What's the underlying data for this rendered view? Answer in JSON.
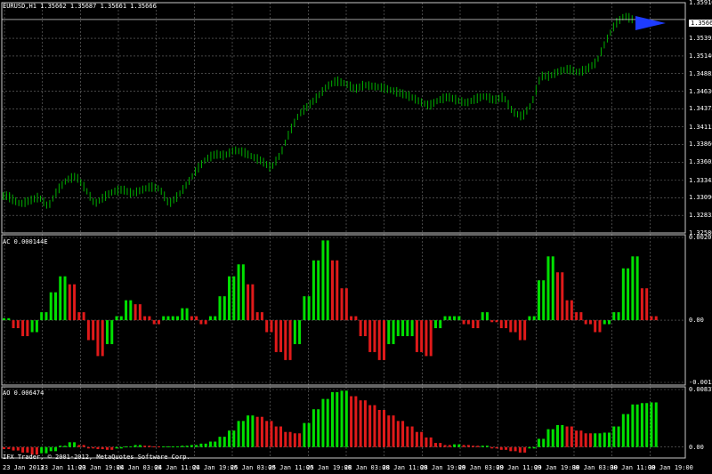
{
  "header": {
    "symbol_label": "EURUSD,H1  1.35662 1.35687 1.35661 1.35666",
    "ac_label": "AC 0.000144E",
    "ao_label": "AO 0.006474",
    "current_price": "1.35666"
  },
  "right_axis": {
    "price_ticks": [
      "1.35910",
      "1.35395",
      "1.35140",
      "1.34885",
      "1.34630",
      "1.34375",
      "1.34115",
      "1.33860",
      "1.33605",
      "1.33345",
      "1.33090",
      "1.32835",
      "1.32580"
    ],
    "ac_ticks": [
      "0.002075",
      "0.00",
      "-0.00156"
    ],
    "ao_ticks": [
      "0.008373",
      "0.00"
    ]
  },
  "time_axis": [
    "23 Jan 2013",
    "23 Jan 11:00",
    "23 Jan 19:00",
    "24 Jan 03:00",
    "24 Jan 11:00",
    "24 Jan 19:00",
    "25 Jan 03:00",
    "25 Jan 11:00",
    "25 Jan 19:00",
    "28 Jan 03:00",
    "28 Jan 11:00",
    "28 Jan 19:00",
    "29 Jan 03:00",
    "29 Jan 11:00",
    "29 Jan 19:00",
    "30 Jan 03:00",
    "30 Jan 11:00",
    "30 Jan 19:00"
  ],
  "copyright": "IFX Trader, © 2001-2012, MetaQuotes Software Corp.",
  "colors": {
    "background": "#000000",
    "grid": "#707070",
    "candles": "#00b000",
    "bar_up": "#00e000",
    "bar_down": "#e01a1a",
    "axis_text": "#ffffff",
    "arrow": "#1e3cff"
  },
  "chart_data": [
    {
      "type": "line",
      "title": "EURUSD,H1",
      "x_range": [
        "23 Jan 2013",
        "30 Jan 19:00"
      ],
      "ylim": [
        1.3258,
        1.3591
      ],
      "series": [
        {
          "name": "EURUSD",
          "values": [
            1.3312,
            1.3308,
            1.33,
            1.3305,
            1.331,
            1.3296,
            1.332,
            1.3335,
            1.334,
            1.3322,
            1.33,
            1.331,
            1.3318,
            1.3321,
            1.3315,
            1.332,
            1.3325,
            1.3322,
            1.33,
            1.3312,
            1.333,
            1.335,
            1.3365,
            1.3372,
            1.337,
            1.3378,
            1.3375,
            1.3368,
            1.3362,
            1.3352,
            1.3372,
            1.3405,
            1.343,
            1.3442,
            1.3455,
            1.347,
            1.3478,
            1.3474,
            1.3466,
            1.3472,
            1.347,
            1.3468,
            1.3464,
            1.346,
            1.3455,
            1.3448,
            1.3442,
            1.345,
            1.3455,
            1.345,
            1.3446,
            1.3452,
            1.3456,
            1.345,
            1.3455,
            1.3433,
            1.3426,
            1.3444,
            1.3485,
            1.3485,
            1.3492,
            1.3495,
            1.349,
            1.3495,
            1.3505,
            1.3535,
            1.356,
            1.3572,
            1.3566
          ]
        }
      ]
    },
    {
      "type": "bar",
      "title": "AC 0.000144E",
      "ylim": [
        -0.00156,
        0.002075
      ],
      "series": [
        {
          "name": "AC",
          "values": [
            5e-05,
            -0.0002,
            -0.0004,
            -0.0003,
            0.0002,
            0.0007,
            0.0011,
            0.0009,
            0.0002,
            -0.0005,
            -0.0009,
            -0.0006,
            0.0001,
            0.0005,
            0.0004,
            0.0001,
            -0.0001,
            0.0001,
            0.0001,
            0.0003,
            0.0001,
            -0.0001,
            0.0001,
            0.0006,
            0.0011,
            0.0014,
            0.0009,
            0.0002,
            -0.0003,
            -0.0008,
            -0.001,
            -0.0006,
            0.0006,
            0.0015,
            0.002,
            0.0015,
            0.0008,
            0.0001,
            -0.0004,
            -0.0008,
            -0.001,
            -0.0006,
            -0.0004,
            -0.0004,
            -0.0008,
            -0.0009,
            -0.0002,
            0.0001,
            0.0001,
            -0.0001,
            -0.0002,
            0.0002,
            -5e-05,
            -0.0002,
            -0.0003,
            -0.0005,
            0.0001,
            0.001,
            0.0016,
            0.0012,
            0.0005,
            0.0002,
            -0.0001,
            -0.0003,
            -0.0001,
            0.0002,
            0.0013,
            0.0016,
            0.0008,
            0.0001
          ]
        }
      ]
    },
    {
      "type": "bar",
      "title": "AO 0.006474",
      "ylim": [
        -0.0012,
        0.008373
      ],
      "series": [
        {
          "name": "AO",
          "values": [
            -0.0003,
            -0.0005,
            -0.0008,
            -0.0011,
            -0.0009,
            -0.0006,
            0.0002,
            0.0007,
            0.0003,
            -0.0002,
            -0.0003,
            -0.0004,
            -0.0002,
            0.0001,
            0.0003,
            0.0002,
            0.0001,
            0.0001,
            0.0001,
            0.0002,
            0.0003,
            0.0005,
            0.0008,
            0.0015,
            0.0024,
            0.0038,
            0.0046,
            0.0044,
            0.0038,
            0.003,
            0.0022,
            0.002,
            0.0035,
            0.0055,
            0.007,
            0.008,
            0.0082,
            0.0074,
            0.0068,
            0.0061,
            0.0054,
            0.0046,
            0.0038,
            0.003,
            0.0022,
            0.0014,
            0.0006,
            0.0003,
            0.0004,
            0.0003,
            0.0002,
            0.0002,
            -0.0002,
            -0.0004,
            -0.0006,
            -0.0008,
            -0.0002,
            0.0012,
            0.0026,
            0.0032,
            0.003,
            0.0024,
            0.002,
            0.002,
            0.0021,
            0.003,
            0.0048,
            0.0062,
            0.0064,
            0.0065
          ]
        }
      ]
    }
  ]
}
